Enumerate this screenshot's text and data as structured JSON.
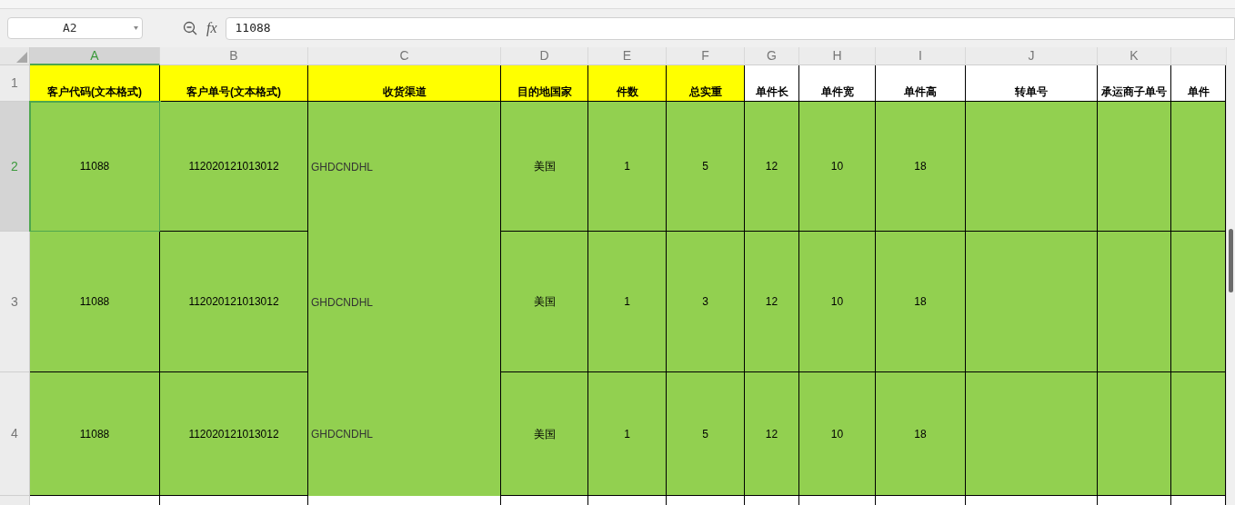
{
  "formula_bar": {
    "name_box": "A2",
    "function_label": "fx",
    "formula": "11088"
  },
  "columns": [
    {
      "label": "A",
      "selected": true
    },
    {
      "label": "B",
      "selected": false
    },
    {
      "label": "C",
      "selected": false
    },
    {
      "label": "D",
      "selected": false
    },
    {
      "label": "E",
      "selected": false
    },
    {
      "label": "F",
      "selected": false
    },
    {
      "label": "G",
      "selected": false
    },
    {
      "label": "H",
      "selected": false
    },
    {
      "label": "I",
      "selected": false
    },
    {
      "label": "J",
      "selected": false
    },
    {
      "label": "K",
      "selected": false
    }
  ],
  "header_row": {
    "row": "1",
    "selected": false,
    "cells": [
      {
        "text": "客户代码(文本格式)",
        "highlighted": true
      },
      {
        "text": "客户单号(文本格式)",
        "highlighted": true
      },
      {
        "text": "收货渠道",
        "highlighted": true
      },
      {
        "text": "目的地国家",
        "highlighted": true
      },
      {
        "text": "件数",
        "highlighted": true
      },
      {
        "text": "总实重",
        "highlighted": true
      },
      {
        "text": "单件长",
        "highlighted": false
      },
      {
        "text": "单件宽",
        "highlighted": false
      },
      {
        "text": "单件高",
        "highlighted": false
      },
      {
        "text": "转单号",
        "highlighted": false
      },
      {
        "text": "承运商子单号",
        "highlighted": false
      },
      {
        "text": "单件",
        "highlighted": false
      }
    ]
  },
  "rows": [
    {
      "row": "2",
      "selected": true,
      "cells": [
        "11088",
        "112020121013012",
        "GHDCNDHL",
        "美国",
        "1",
        "5",
        "12",
        "10",
        "18"
      ]
    },
    {
      "row": "3",
      "selected": false,
      "cells": [
        "11088",
        "112020121013012",
        "GHDCNDHL",
        "美国",
        "1",
        "3",
        "12",
        "10",
        "18"
      ]
    },
    {
      "row": "4",
      "selected": false,
      "cells": [
        "11088",
        "112020121013012",
        "GHDCNDHL",
        "美国",
        "1",
        "5",
        "12",
        "10",
        "18"
      ]
    }
  ]
}
